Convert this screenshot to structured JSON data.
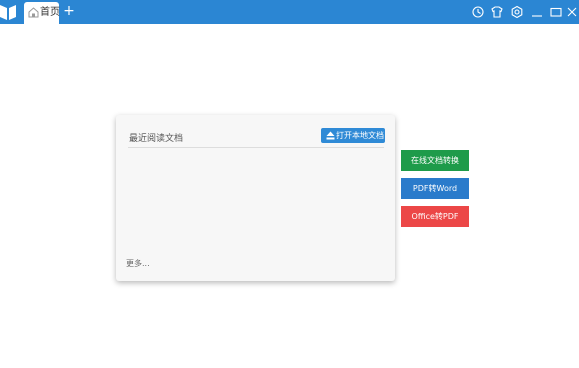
{
  "header": {
    "tabs": [
      {
        "label": "首页",
        "icon": "home-icon"
      }
    ],
    "add_tab_label": "+",
    "colors": {
      "bar": "#2b86d3"
    },
    "window_controls": [
      "history-icon",
      "skin-icon",
      "settings-icon",
      "minimize-icon",
      "maximize-icon",
      "close-icon"
    ]
  },
  "recent_panel": {
    "title": "最近阅读文档",
    "open_button_label": "打开本地文档",
    "more_link": "更多..."
  },
  "actions": [
    {
      "label": "在线文档转换",
      "color": "#1e9b4a"
    },
    {
      "label": "PDF转Word",
      "color": "#2a7bcb"
    },
    {
      "label": "Office转PDF",
      "color": "#ec4747"
    }
  ]
}
